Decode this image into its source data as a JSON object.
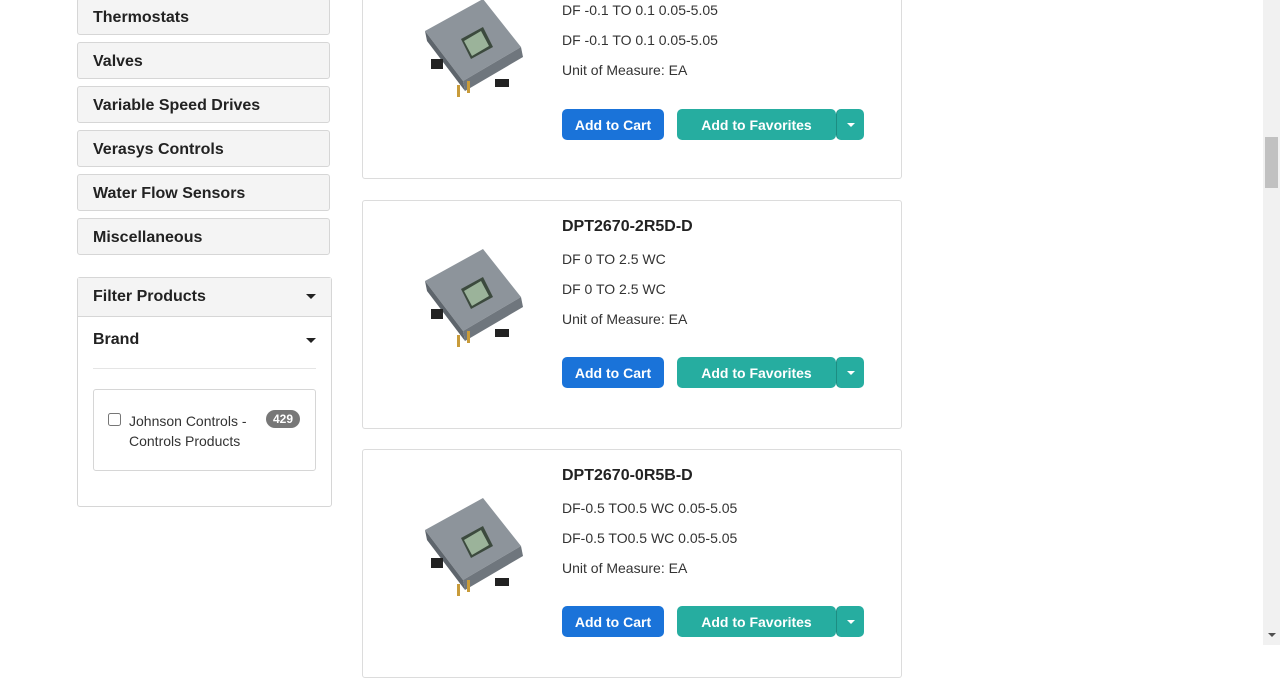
{
  "sidebar": {
    "categories": [
      {
        "label": "Thermostats"
      },
      {
        "label": "Valves"
      },
      {
        "label": "Variable Speed Drives"
      },
      {
        "label": "Verasys Controls"
      },
      {
        "label": "Water Flow Sensors"
      },
      {
        "label": "Miscellaneous"
      }
    ],
    "filter": {
      "title": "Filter Products",
      "brand_title": "Brand",
      "brands": [
        {
          "label": "Johnson Controls - Controls Products",
          "count": "429",
          "checked": false
        }
      ]
    }
  },
  "products": [
    {
      "title": "",
      "line1": "DF -0.1 TO 0.1 0.05-5.05",
      "line2": "DF -0.1 TO 0.1 0.05-5.05",
      "uom": "Unit of Measure: EA",
      "add_cart": "Add to Cart",
      "add_fav": "Add to Favorites"
    },
    {
      "title": "DPT2670-2R5D-D",
      "line1": "DF 0 TO 2.5 WC",
      "line2": "DF 0 TO 2.5 WC",
      "uom": "Unit of Measure: EA",
      "add_cart": "Add to Cart",
      "add_fav": "Add to Favorites"
    },
    {
      "title": "DPT2670-0R5B-D",
      "line1": "DF-0.5 TO0.5 WC 0.05-5.05",
      "line2": "DF-0.5 TO0.5 WC 0.05-5.05",
      "uom": "Unit of Measure: EA",
      "add_cart": "Add to Cart",
      "add_fav": "Add to Favorites"
    }
  ],
  "colors": {
    "cart_button": "#1a73d9",
    "favorites_button": "#26ada0",
    "badge": "#777777"
  }
}
